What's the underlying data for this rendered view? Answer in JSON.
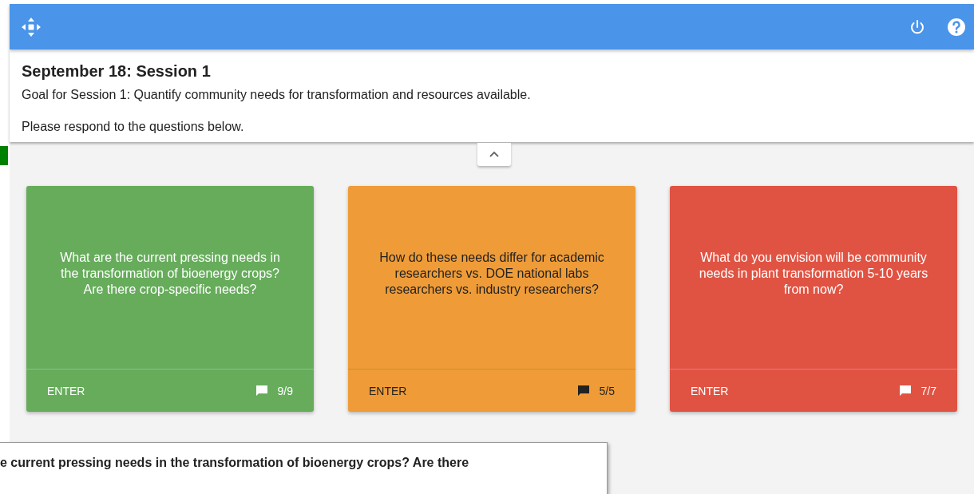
{
  "session": {
    "title": "September 18: Session 1",
    "goal": "Goal for Session 1: Quantify community needs for transformation and resources available.",
    "instruction": "Please respond to the questions below."
  },
  "cards": [
    {
      "question": "What are the current pressing needs in the transformation of bioenergy crops? Are there crop-specific needs?",
      "color": "#66ac5b",
      "action": "ENTER",
      "count": "9/9"
    },
    {
      "question": "How do these needs differ for academic researchers vs. DOE national labs researchers vs. industry researchers?",
      "color": "#ef9c38",
      "action": "ENTER",
      "count": "5/5"
    },
    {
      "question": "What do you envision will be community needs in plant transformation 5-10 years from now?",
      "color": "#e05343",
      "action": "ENTER",
      "count": "7/7"
    }
  ],
  "popup": {
    "text": "e current pressing needs in the transformation of bioenergy crops? Are there"
  }
}
